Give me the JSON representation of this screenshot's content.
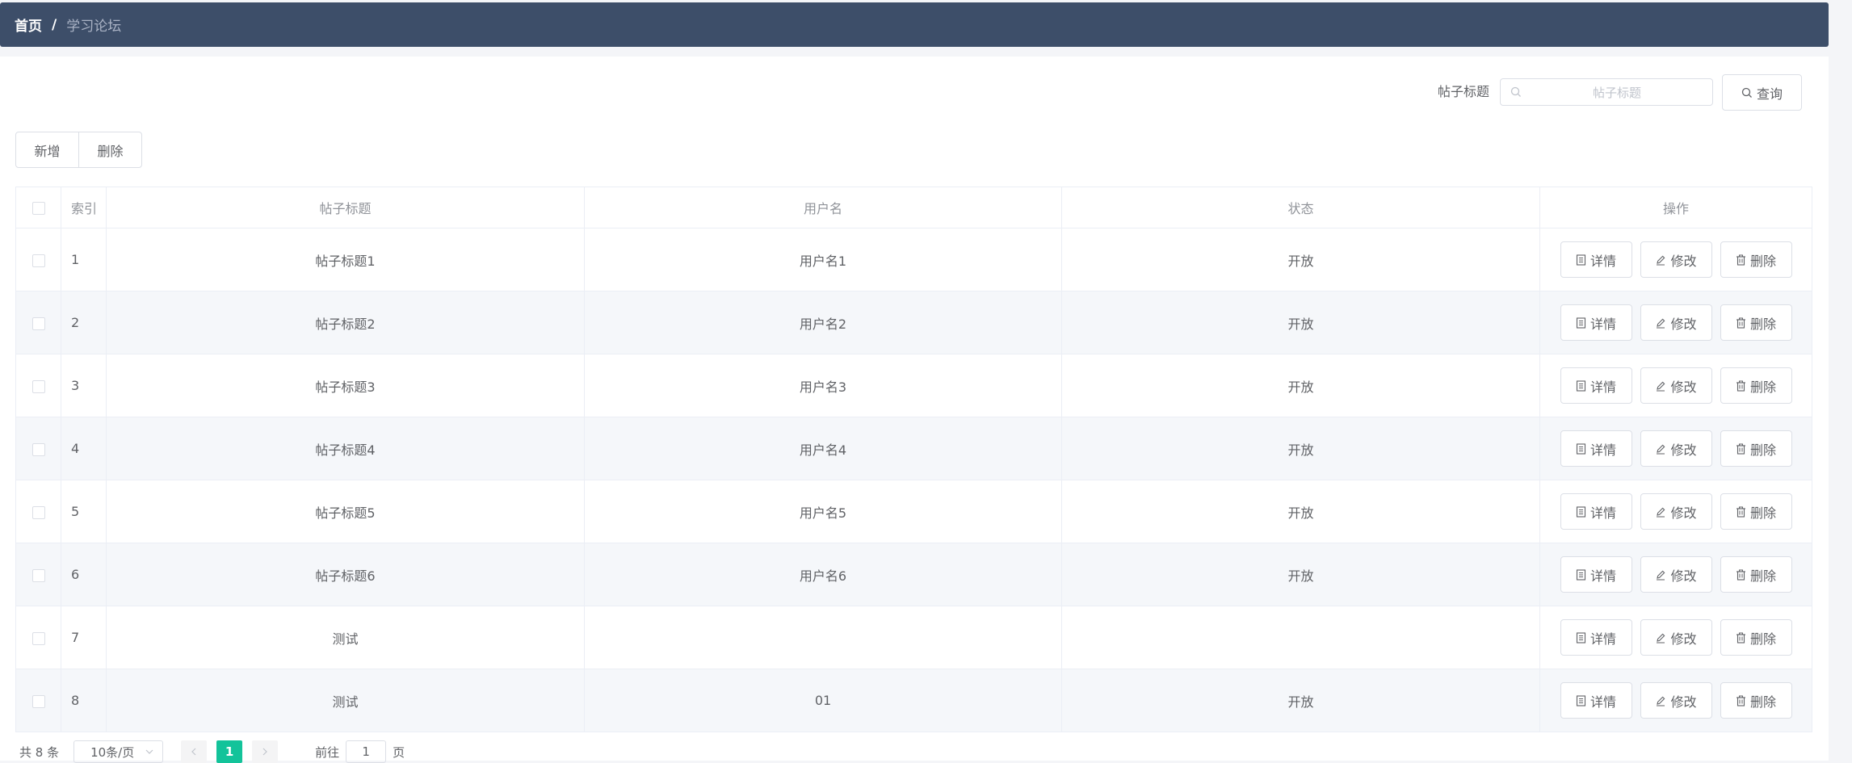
{
  "breadcrumb": {
    "home": "首页",
    "separator": "/",
    "current": "学习论坛"
  },
  "search": {
    "label": "帖子标题",
    "placeholder": "帖子标题",
    "value": "",
    "icon": "search-icon",
    "button": "查询"
  },
  "toolbar": {
    "add": "新增",
    "delete": "删除"
  },
  "table": {
    "headers": {
      "index": "索引",
      "title": "帖子标题",
      "username": "用户名",
      "status": "状态",
      "actions": "操作"
    },
    "rows": [
      {
        "index": "1",
        "title": "帖子标题1",
        "username": "用户名1",
        "status": "开放"
      },
      {
        "index": "2",
        "title": "帖子标题2",
        "username": "用户名2",
        "status": "开放"
      },
      {
        "index": "3",
        "title": "帖子标题3",
        "username": "用户名3",
        "status": "开放"
      },
      {
        "index": "4",
        "title": "帖子标题4",
        "username": "用户名4",
        "status": "开放"
      },
      {
        "index": "5",
        "title": "帖子标题5",
        "username": "用户名5",
        "status": "开放"
      },
      {
        "index": "6",
        "title": "帖子标题6",
        "username": "用户名6",
        "status": "开放"
      },
      {
        "index": "7",
        "title": "测试",
        "username": "",
        "status": ""
      },
      {
        "index": "8",
        "title": "测试",
        "username": "01",
        "status": "开放"
      }
    ],
    "row_actions": {
      "detail": "详情",
      "edit": "修改",
      "delete": "删除"
    }
  },
  "pagination": {
    "total": "共 8 条",
    "page_size": "10条/页",
    "current_page": "1",
    "goto_label": "前往",
    "goto_value": "1",
    "page_suffix": "页"
  },
  "colors": {
    "header_bg": "#3d4e69",
    "accent": "#13c39a",
    "stripe": "#f5f7fa",
    "border": "#ebeef5"
  }
}
